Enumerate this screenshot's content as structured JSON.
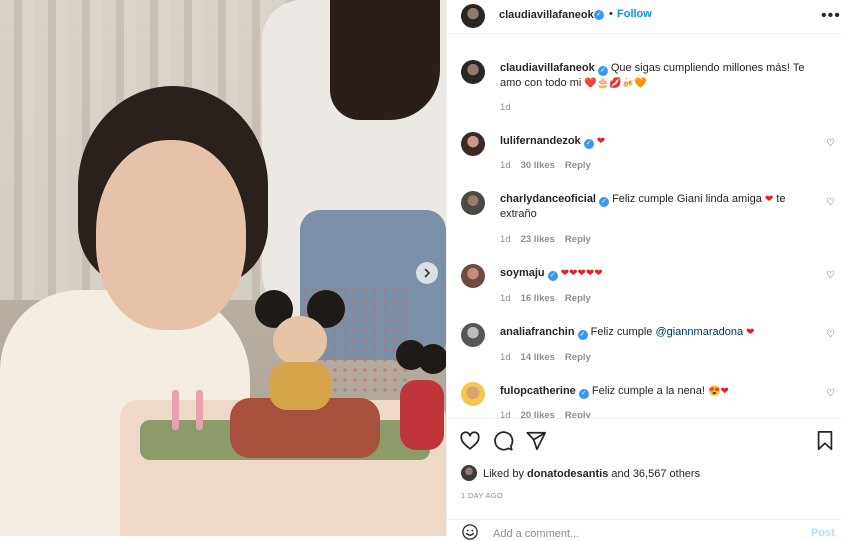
{
  "post": {
    "author": "claudiavillafaneok",
    "follow_label": "Follow",
    "more_label": "•••"
  },
  "caption": {
    "username": "claudiavillafaneok",
    "text": "Que sigas cumpliendo millones más! Te amo con todo mi",
    "emojis": "❤️🎂💋🍻🧡",
    "time": "1d"
  },
  "comments": [
    {
      "username": "lulifernandezok",
      "text": "",
      "emojis": "❤",
      "time": "1d",
      "likes": "30 likes",
      "reply": "Reply"
    },
    {
      "username": "charlydanceoficial",
      "text": "Feliz cumple Giani linda amiga",
      "emojis": "❤",
      "text_after": "te extraño",
      "time": "1d",
      "likes": "23 likes",
      "reply": "Reply"
    },
    {
      "username": "soymaju",
      "text": "",
      "emojis": "❤❤❤❤❤",
      "time": "1d",
      "likes": "16 likes",
      "reply": "Reply"
    },
    {
      "username": "analiafranchin",
      "text": "Feliz cumple",
      "mention": "@giannmaradona",
      "emojis": "❤",
      "time": "1d",
      "likes": "14 likes",
      "reply": "Reply"
    },
    {
      "username": "fulopcatherine",
      "text": "Feliz cumple a la nena!",
      "emojis": "😍❤",
      "time": "1d",
      "likes": "20 likes",
      "reply": "Reply"
    }
  ],
  "likes": {
    "prefix": "Liked by",
    "user": "donatodesantis",
    "suffix": "and 36,567 others"
  },
  "date": "1 DAY AGO",
  "add_comment": {
    "placeholder": "Add a comment...",
    "post_label": "Post"
  },
  "colors": {
    "accent": "#0095f6",
    "verified": "#3897f0",
    "heart": "#ed1c24",
    "muted": "#8e8e8e"
  },
  "icons": [
    "verified-badge-icon",
    "heart-icon",
    "comment-icon",
    "share-icon",
    "bookmark-icon",
    "chevron-right-icon",
    "emoji-icon",
    "more-icon"
  ]
}
